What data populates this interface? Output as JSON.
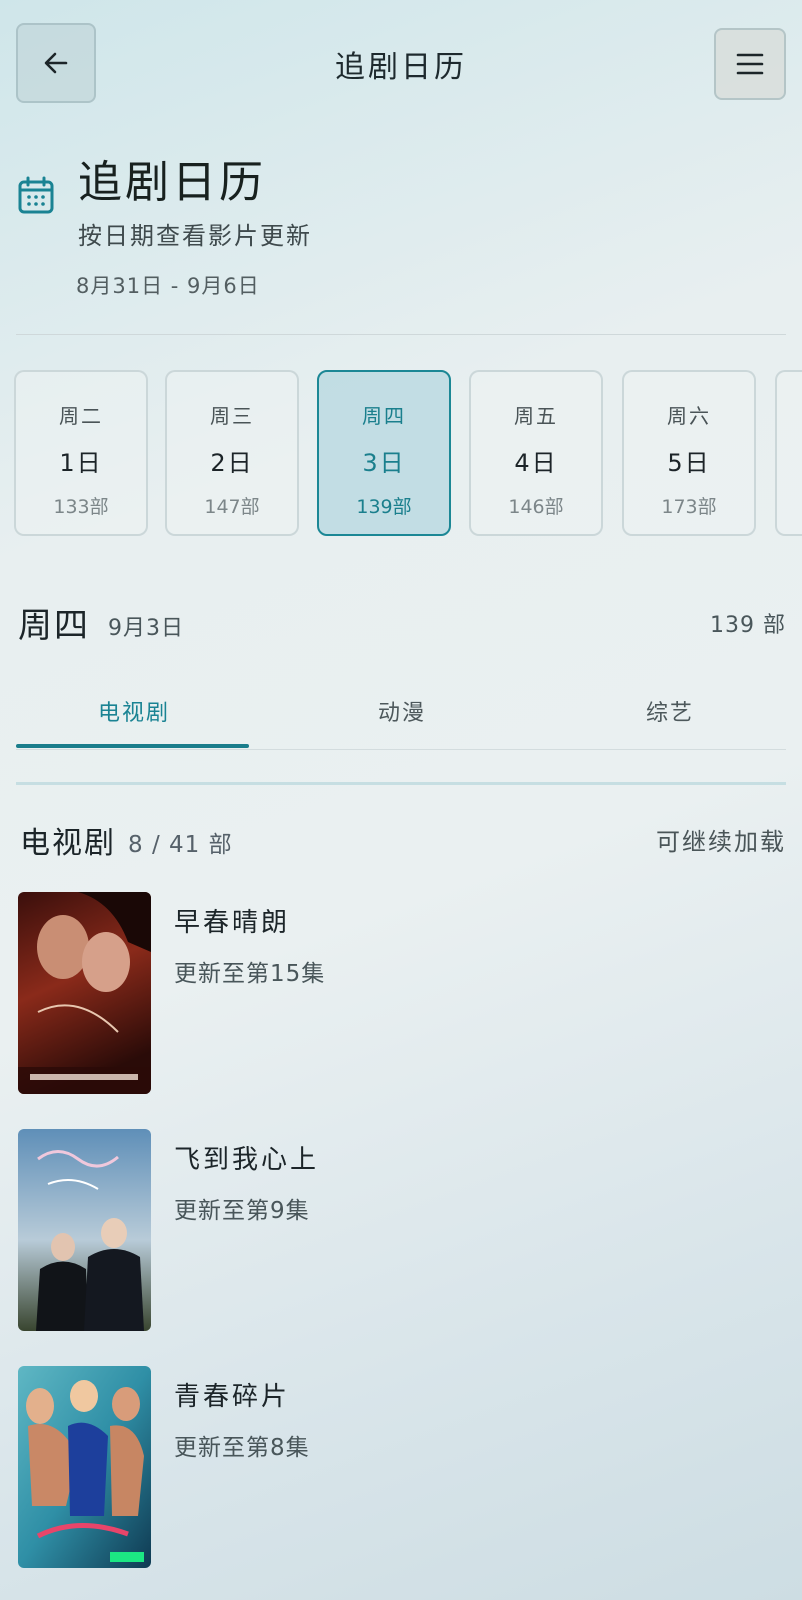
{
  "topbar": {
    "title": "追剧日历",
    "back_icon": "arrow-left-icon",
    "menu_icon": "hamburger-menu-icon"
  },
  "header": {
    "title": "追剧日历",
    "subtitle": "按日期查看影片更新",
    "range": "8月31日 - 9月6日",
    "icon": "calendar-icon",
    "accent": "#1a8393"
  },
  "days": [
    {
      "weekday": "周二",
      "date": "1日",
      "count": "133部",
      "active": false
    },
    {
      "weekday": "周三",
      "date": "2日",
      "count": "147部",
      "active": false
    },
    {
      "weekday": "周四",
      "date": "3日",
      "count": "139部",
      "active": true
    },
    {
      "weekday": "周五",
      "date": "4日",
      "count": "146部",
      "active": false
    },
    {
      "weekday": "周六",
      "date": "5日",
      "count": "173部",
      "active": false
    }
  ],
  "selected": {
    "weekday": "周四",
    "date": "9月3日",
    "count": "139 部"
  },
  "tabs": [
    {
      "label": "电视剧",
      "active": true
    },
    {
      "label": "动漫",
      "active": false
    },
    {
      "label": "综艺",
      "active": false
    }
  ],
  "list": {
    "title": "电视剧",
    "count": "8 / 41 部",
    "more": "可继续加载",
    "items": [
      {
        "title": "早春晴朗",
        "subtitle": "更新至第15集"
      },
      {
        "title": "飞到我心上",
        "subtitle": "更新至第9集"
      },
      {
        "title": "青春碎片",
        "subtitle": "更新至第8集"
      }
    ]
  }
}
